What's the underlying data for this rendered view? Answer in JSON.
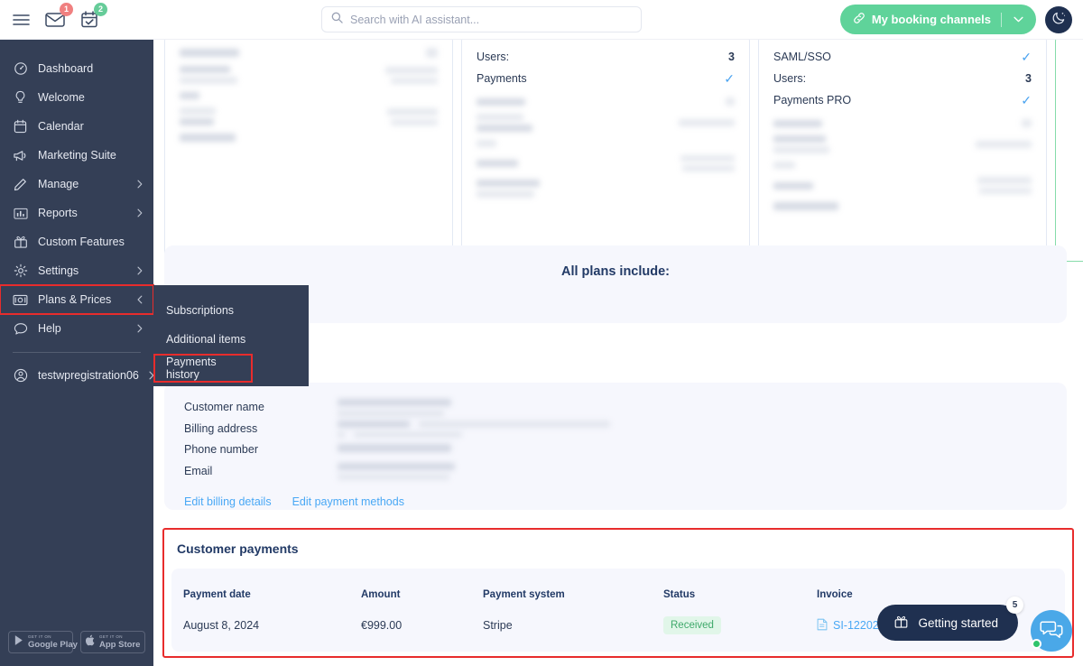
{
  "topbar": {
    "menu_icon": "hamburger-menu-icon",
    "mail_icon": "mail-icon",
    "mail_badge": "1",
    "calendar_icon": "calendar-check-icon",
    "calendar_badge": "2",
    "search_placeholder": "Search with AI assistant...",
    "search_value": "",
    "search_icon": "search-icon",
    "booking_label": "My booking channels",
    "booking_icon": "link-icon",
    "booking_caret": "chevron-down-icon",
    "theme_icon": "moon-icon",
    "accent_green": "#5fd39a",
    "dark_navy": "#1f3050"
  },
  "sidebar": {
    "bg": "#343f56",
    "items": [
      {
        "label": "Dashboard",
        "icon": "gauge-icon",
        "caret": false
      },
      {
        "label": "Welcome",
        "icon": "lightbulb-icon",
        "caret": false
      },
      {
        "label": "Calendar",
        "icon": "calendar-icon",
        "caret": false
      },
      {
        "label": "Marketing Suite",
        "icon": "megaphone-icon",
        "caret": false
      },
      {
        "label": "Manage",
        "icon": "pencil-icon",
        "caret": true
      },
      {
        "label": "Reports",
        "icon": "bar-chart-icon",
        "caret": true
      },
      {
        "label": "Custom Features",
        "icon": "gift-icon",
        "caret": false
      },
      {
        "label": "Settings",
        "icon": "gear-icon",
        "caret": true
      },
      {
        "label": "Plans & Prices",
        "icon": "money-icon",
        "caret": true,
        "caret_dir": "left",
        "highlighted": true
      },
      {
        "label": "Help",
        "icon": "chat-bubble-icon",
        "caret": true
      }
    ],
    "account": {
      "label": "testwpregistration06",
      "icon": "user-circle-icon",
      "caret": true
    },
    "store_badges": [
      {
        "top": "GET IT ON",
        "main": "Google Play",
        "icon": "google-play-icon"
      },
      {
        "top": "GET IT ON",
        "main": "App Store",
        "icon": "apple-icon"
      }
    ]
  },
  "submenu": {
    "items": [
      {
        "label": "Subscriptions",
        "highlighted": false
      },
      {
        "label": "Additional items",
        "highlighted": false
      },
      {
        "label": "Payments history",
        "highlighted": true
      }
    ],
    "highlight_color": "#e82c2c"
  },
  "plans": {
    "cards": [
      {
        "features": []
      },
      {
        "features": [
          {
            "label": "Users:",
            "value": "3",
            "type": "value"
          },
          {
            "label": "Payments",
            "value": "✓",
            "type": "check"
          }
        ]
      },
      {
        "features": [
          {
            "label": "SAML/SSO",
            "value": "✓",
            "type": "check"
          },
          {
            "label": "Users:",
            "value": "3",
            "type": "value"
          },
          {
            "label": "Payments PRO",
            "value": "✓",
            "type": "check"
          }
        ]
      }
    ]
  },
  "all_plans": {
    "title": "All plans include:"
  },
  "billing": {
    "rows": [
      {
        "label": "Customer name"
      },
      {
        "label": "Billing address"
      },
      {
        "label": "Phone number"
      },
      {
        "label": "Email"
      }
    ],
    "links": [
      {
        "label": "Edit billing details"
      },
      {
        "label": "Edit payment methods"
      }
    ],
    "link_color": "#49a8f5"
  },
  "payments": {
    "title": "Customer payments",
    "columns": [
      "Payment date",
      "Amount",
      "Payment system",
      "Status",
      "Invoice"
    ],
    "rows": [
      {
        "date": "August 8, 2024",
        "amount": "€999.00",
        "system": "Stripe",
        "status": "Received",
        "invoice": "SI-12202",
        "invoice_icon": "document-icon"
      }
    ],
    "status_color": "#3fa96b",
    "status_bg": "#e1f6e9",
    "highlight_color": "#e82c2c"
  },
  "widgets": {
    "getting_started_label": "Getting started",
    "getting_started_icon": "gift-icon",
    "getting_started_count": "5",
    "chat_icon": "chat-bubbles-icon",
    "chat_online": true
  }
}
